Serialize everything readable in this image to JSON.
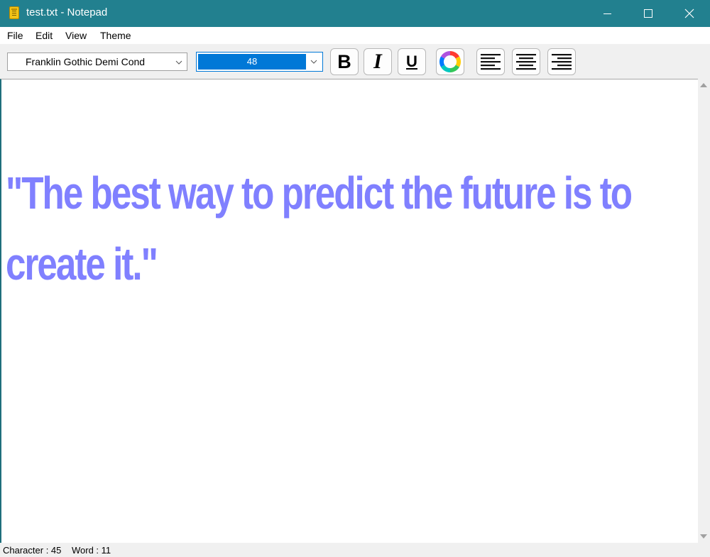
{
  "window": {
    "title": "test.txt - Notepad"
  },
  "menu": {
    "items": [
      "File",
      "Edit",
      "View",
      "Theme"
    ]
  },
  "toolbar": {
    "font_family": "Franklin Gothic Demi Cond",
    "font_size": "48",
    "bold": "B",
    "italic": "I",
    "underline": "U",
    "icons": {
      "color": "color-wheel-icon",
      "align_left": "align-left-icon",
      "align_center": "align-center-icon",
      "align_right": "align-right-icon"
    }
  },
  "editor": {
    "text": "\"The best way to predict the future is to create it.\"",
    "text_color": "#8080ff"
  },
  "status": {
    "character": "Character : 45",
    "word": "Word : 11"
  }
}
